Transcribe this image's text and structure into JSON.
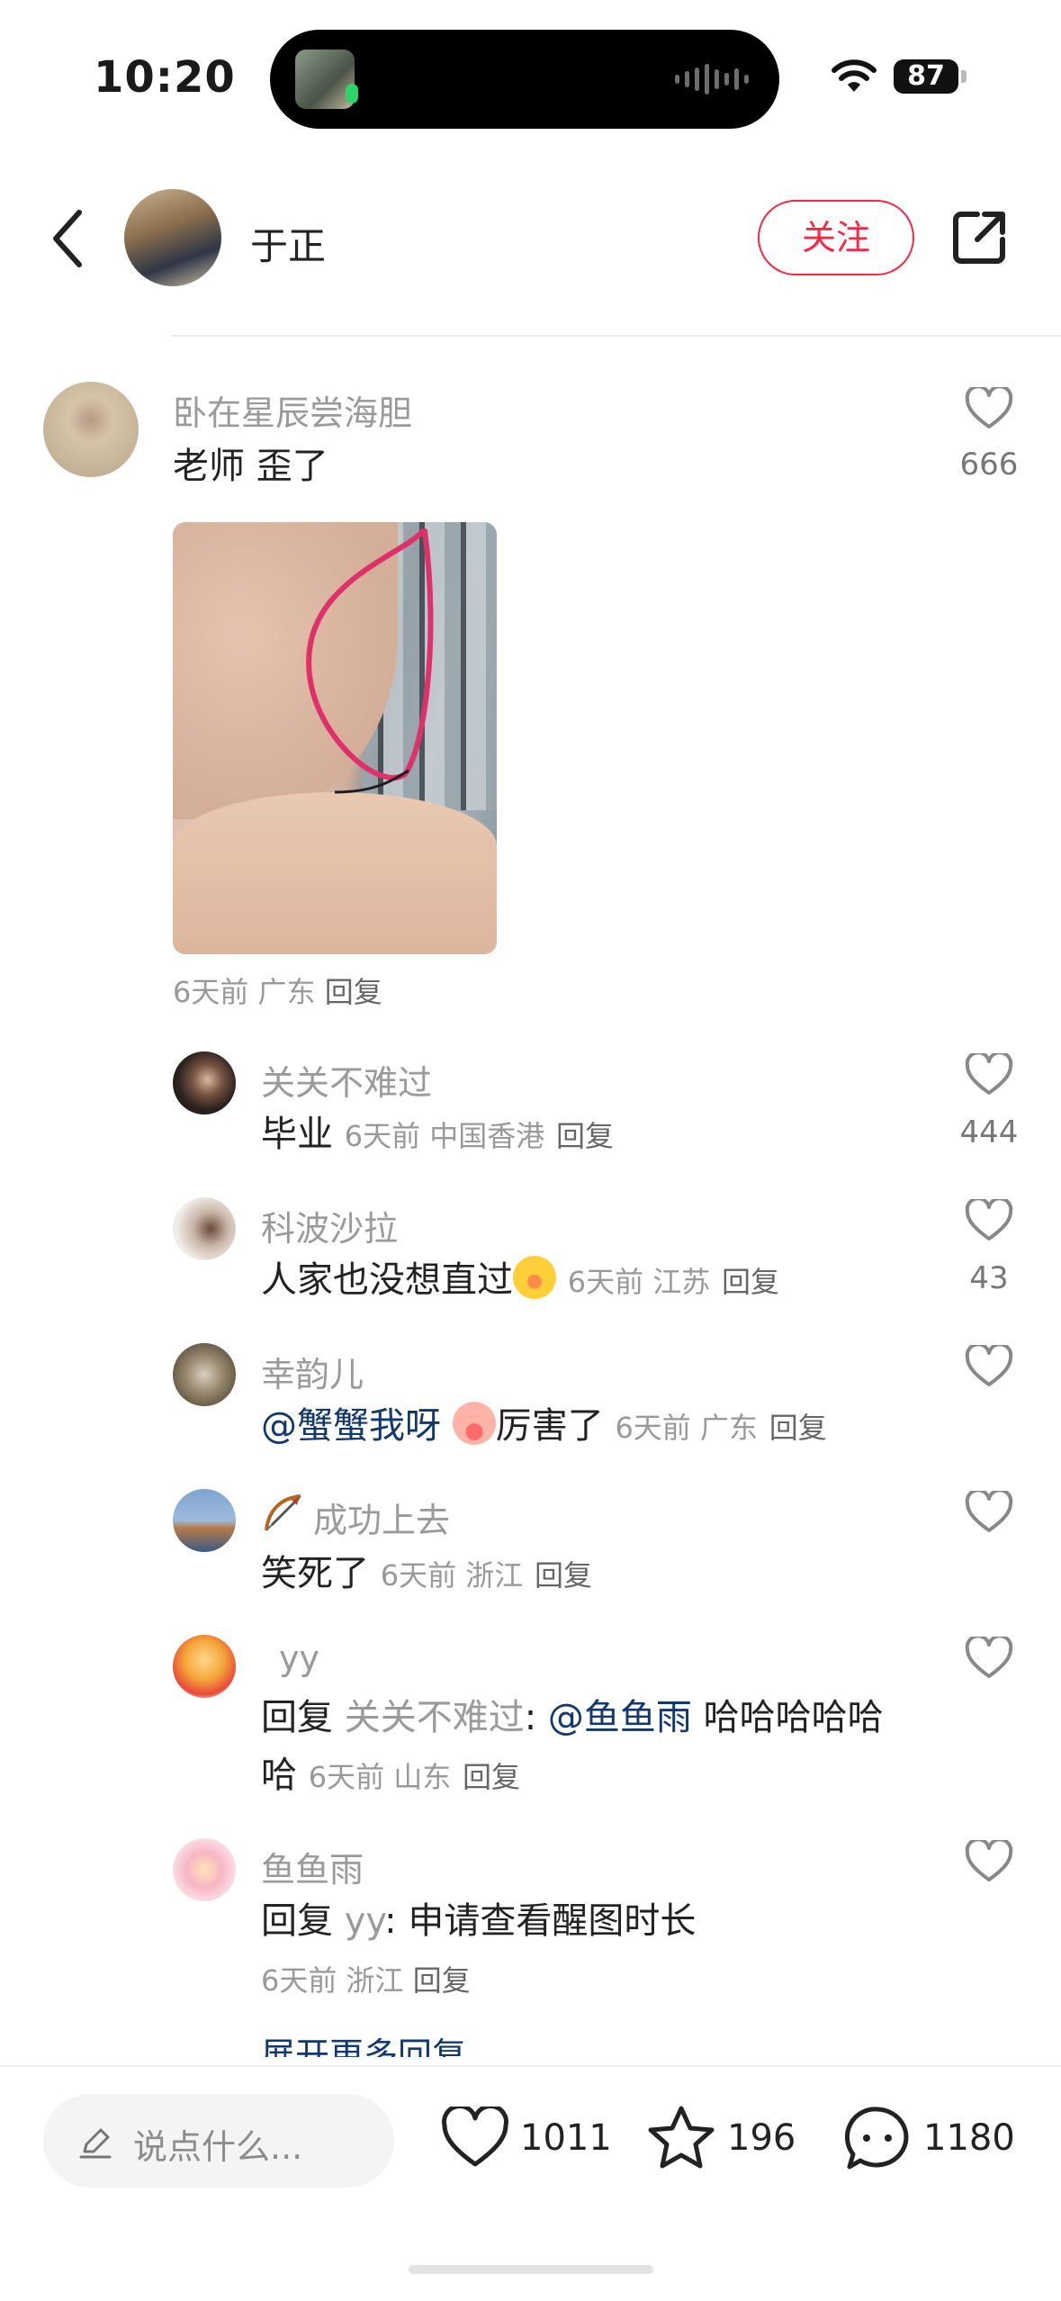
{
  "status_bar": {
    "time": "10:20",
    "battery": "87"
  },
  "header": {
    "author": "于正",
    "follow_label": "关注"
  },
  "main_comment": {
    "username": "卧在星辰尝海胆",
    "text": "老师 歪了",
    "likes": "666",
    "meta": "6天前 广东",
    "reply_label": "回复"
  },
  "replies": [
    {
      "username": "关关不难过",
      "text": "毕业",
      "meta": "6天前 中国香港",
      "reply_label": "回复",
      "likes": "444"
    },
    {
      "username": "科波沙拉",
      "text": "人家也没想直过",
      "meta": "6天前 江苏",
      "reply_label": "回复",
      "likes": "43"
    },
    {
      "username": "幸韵儿",
      "mention": "@蟹蟹我呀",
      "text": "厉害了",
      "meta": "6天前 广东",
      "reply_label": "回复",
      "likes": ""
    },
    {
      "username": "成功上去",
      "text": "笑死了",
      "meta": "6天前 浙江",
      "reply_label": "回复",
      "likes": ""
    },
    {
      "username": "yy",
      "prefix": "回复",
      "reply_to": "关关不难过",
      "mention": "@鱼鱼雨",
      "text_line1": "哈哈哈哈哈",
      "text_line2": "哈",
      "meta": "6天前 山东",
      "reply_label": "回复",
      "likes": ""
    },
    {
      "username": "鱼鱼雨",
      "prefix": "回复",
      "reply_to": "yy",
      "text": "申请查看醒图时长",
      "meta": "6天前 浙江",
      "reply_label": "回复",
      "likes": ""
    }
  ],
  "expand_label": "展开更多回复",
  "bottom_bar": {
    "input_placeholder": "说点什么...",
    "likes": "1011",
    "stars": "196",
    "comments": "1180"
  },
  "colors": {
    "accent": "#ff2442",
    "mention": "#13386c",
    "meta": "#999999"
  }
}
